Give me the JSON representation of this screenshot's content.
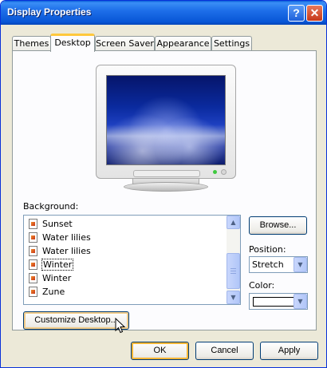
{
  "window": {
    "title": "Display Properties"
  },
  "titlebar_buttons": {
    "help": "?",
    "close": "✕"
  },
  "tabs": [
    {
      "label": "Themes"
    },
    {
      "label": "Desktop"
    },
    {
      "label": "Screen Saver"
    },
    {
      "label": "Appearance"
    },
    {
      "label": "Settings"
    }
  ],
  "active_tab": "Desktop",
  "desktop": {
    "background_label": "Background:",
    "background_items": [
      {
        "name": "Sunset",
        "icon": "image-file-icon"
      },
      {
        "name": "Water lilies",
        "icon": "image-file-icon"
      },
      {
        "name": "Water lilies",
        "icon": "image-file-icon"
      },
      {
        "name": "Winter",
        "icon": "image-file-icon",
        "selected": true
      },
      {
        "name": "Winter",
        "icon": "image-file-icon"
      },
      {
        "name": "Zune",
        "icon": "image-file-icon"
      }
    ],
    "browse_label": "Browse...",
    "position_label": "Position:",
    "position_value": "Stretch",
    "color_label": "Color:",
    "color_value": "#ffffff",
    "customize_label": "Customize Desktop..."
  },
  "footer": {
    "ok_label": "OK",
    "cancel_label": "Cancel",
    "apply_label": "Apply"
  },
  "colors": {
    "titlebar": "#0856d6",
    "dialog_bg": "#ece9d8",
    "tab_highlight": "#ffc83c",
    "close_button": "#c6381a"
  }
}
